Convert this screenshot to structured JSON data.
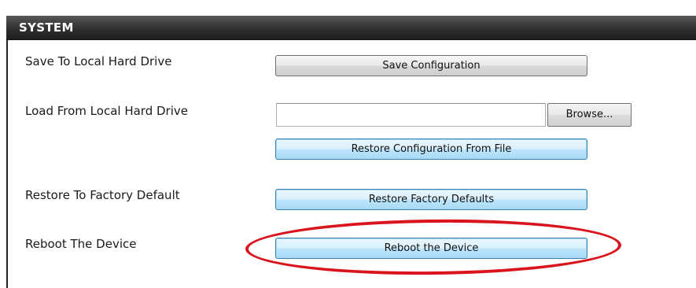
{
  "section": {
    "title": "SYSTEM"
  },
  "rows": {
    "save": {
      "label": "Save To Local Hard Drive",
      "button": "Save Configuration"
    },
    "load": {
      "label": "Load From Local Hard Drive",
      "file_value": "",
      "browse": "Browse...",
      "button": "Restore Configuration From File"
    },
    "factory": {
      "label": "Restore To Factory Default",
      "button": "Restore Factory Defaults"
    },
    "reboot": {
      "label": "Reboot The Device",
      "button": "Reboot the Device"
    }
  },
  "colors": {
    "header_background": "#2f2f2f",
    "highlight_ring": "#d9141c",
    "focus_border": "#3c7fb1"
  }
}
